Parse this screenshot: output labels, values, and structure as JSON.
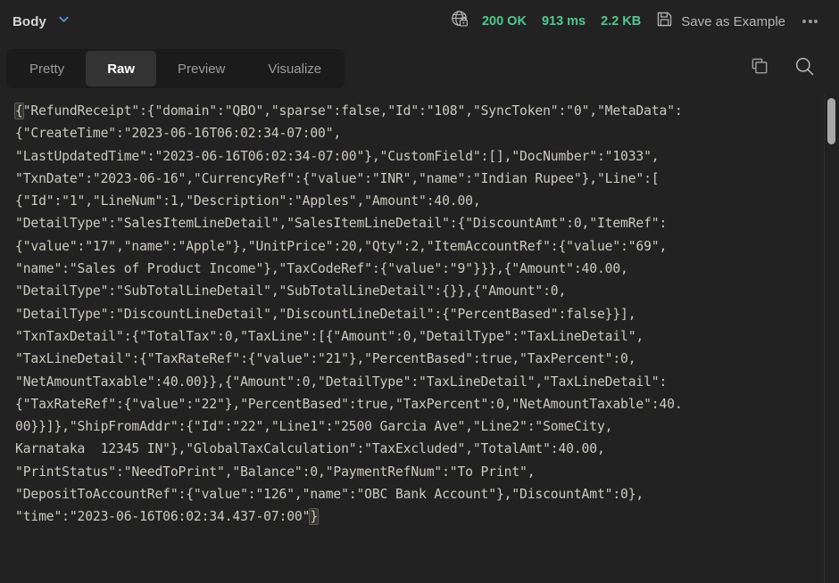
{
  "topbar": {
    "body_label": "Body",
    "chevron_icon": "chevron-down-icon",
    "globe_lock_icon": "globe-lock-icon",
    "status_code": "200 OK",
    "time": "913 ms",
    "size": "2.2 KB",
    "save_icon": "floppy-disk-icon",
    "save_label": "Save as Example",
    "more_icon": "more-horizontal-icon",
    "accent_green": "#4ec98e",
    "accent_blue": "#5a9ce8"
  },
  "tabs": [
    {
      "label": "Pretty",
      "active": false
    },
    {
      "label": "Raw",
      "active": true
    },
    {
      "label": "Preview",
      "active": false
    },
    {
      "label": "Visualize",
      "active": false
    }
  ],
  "tools": {
    "copy_icon": "copy-icon",
    "search_icon": "search-icon"
  },
  "response": {
    "line_01a": "{",
    "line_01b": "\"RefundReceipt\":{\"domain\":\"QBO\",\"sparse\":false,\"Id\":\"108\",\"SyncToken\":\"0\",\"MetaData\":",
    "line_02": "{\"CreateTime\":\"2023-06-16T06:02:34-07:00\",",
    "line_03": "\"LastUpdatedTime\":\"2023-06-16T06:02:34-07:00\"},\"CustomField\":[],\"DocNumber\":\"1033\",",
    "line_04": "\"TxnDate\":\"2023-06-16\",\"CurrencyRef\":{\"value\":\"INR\",\"name\":\"Indian Rupee\"},\"Line\":[",
    "line_05": "{\"Id\":\"1\",\"LineNum\":1,\"Description\":\"Apples\",\"Amount\":40.00,",
    "line_06": "\"DetailType\":\"SalesItemLineDetail\",\"SalesItemLineDetail\":{\"DiscountAmt\":0,\"ItemRef\":",
    "line_07": "{\"value\":\"17\",\"name\":\"Apple\"},\"UnitPrice\":20,\"Qty\":2,\"ItemAccountRef\":{\"value\":\"69\",",
    "line_08": "\"name\":\"Sales of Product Income\"},\"TaxCodeRef\":{\"value\":\"9\"}}},{\"Amount\":40.00,",
    "line_09": "\"DetailType\":\"SubTotalLineDetail\",\"SubTotalLineDetail\":{}},{\"Amount\":0,",
    "line_10": "\"DetailType\":\"DiscountLineDetail\",\"DiscountLineDetail\":{\"PercentBased\":false}}],",
    "line_11": "\"TxnTaxDetail\":{\"TotalTax\":0,\"TaxLine\":[{\"Amount\":0,\"DetailType\":\"TaxLineDetail\",",
    "line_12": "\"TaxLineDetail\":{\"TaxRateRef\":{\"value\":\"21\"},\"PercentBased\":true,\"TaxPercent\":0,",
    "line_13": "\"NetAmountTaxable\":40.00}},{\"Amount\":0,\"DetailType\":\"TaxLineDetail\",\"TaxLineDetail\":",
    "line_14": "{\"TaxRateRef\":{\"value\":\"22\"},\"PercentBased\":true,\"TaxPercent\":0,\"NetAmountTaxable\":40.",
    "line_15": "00}}]},\"ShipFromAddr\":{\"Id\":\"22\",\"Line1\":\"2500 Garcia Ave\",\"Line2\":\"SomeCity,",
    "line_16": "Karnataka  12345 IN\"},\"GlobalTaxCalculation\":\"TaxExcluded\",\"TotalAmt\":40.00,",
    "line_17": "\"PrintStatus\":\"NeedToPrint\",\"Balance\":0,\"PaymentRefNum\":\"To Print\",",
    "line_18": "\"DepositToAccountRef\":{\"value\":\"126\",\"name\":\"OBC Bank Account\"},\"DiscountAmt\":0},",
    "line_19a": "\"time\":\"2023-06-16T06:02:34.437-07:00\"",
    "line_19b": "}"
  }
}
